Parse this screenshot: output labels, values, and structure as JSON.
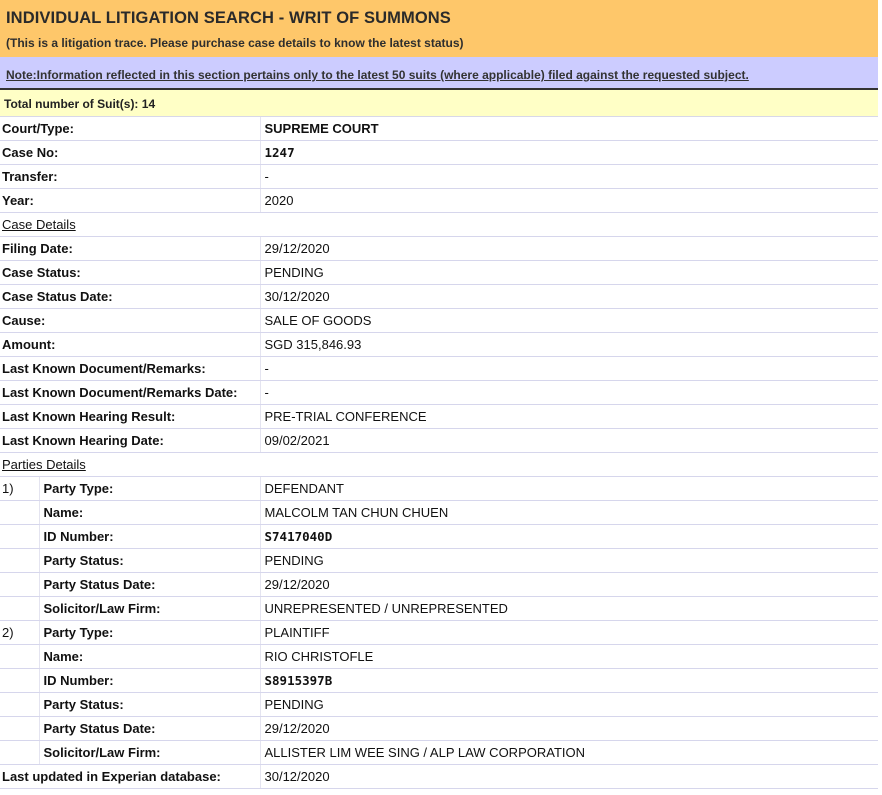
{
  "header": {
    "title": "INDIVIDUAL LITIGATION SEARCH - WRIT OF SUMMONS",
    "subtitle": "(This is a litigation trace. Please purchase case details to know the latest status)",
    "note": "Note:Information reflected in this section pertains only to the latest 50 suits (where applicable) filed against the requested subject.",
    "total": "Total number of Suit(s): 14"
  },
  "case": {
    "court_type_label": "Court/Type:",
    "court_type": "SUPREME COURT",
    "case_no_label": "Case No:",
    "case_no": "1247",
    "transfer_label": "Transfer:",
    "transfer": "-",
    "year_label": "Year:",
    "year": "2020"
  },
  "case_details": {
    "heading": "Case Details",
    "filing_date_label": "Filing Date:",
    "filing_date": "29/12/2020",
    "status_label": "Case Status:",
    "status": "PENDING",
    "status_date_label": "Case Status Date:",
    "status_date": "30/12/2020",
    "cause_label": "Cause:",
    "cause": "SALE OF GOODS",
    "amount_label": "Amount:",
    "amount": "SGD 315,846.93",
    "last_doc_label": "Last Known Document/Remarks:",
    "last_doc": "-",
    "last_doc_date_label": "Last Known Document/Remarks Date:",
    "last_doc_date": "-",
    "hearing_result_label": "Last Known Hearing Result:",
    "hearing_result": "PRE-TRIAL CONFERENCE",
    "hearing_date_label": "Last Known Hearing Date:",
    "hearing_date": "09/02/2021"
  },
  "parties": {
    "heading": "Parties Details",
    "labels": {
      "type": "Party Type:",
      "name": "Name:",
      "id": "ID Number:",
      "status": "Party Status:",
      "status_date": "Party Status Date:",
      "solicitor": "Solicitor/Law Firm:"
    },
    "items": [
      {
        "num": "1)",
        "type": "DEFENDANT",
        "name": "MALCOLM TAN CHUN CHUEN",
        "id": "S7417040D",
        "status": "PENDING",
        "status_date": "29/12/2020",
        "solicitor": "UNREPRESENTED / UNREPRESENTED"
      },
      {
        "num": "2)",
        "type": "PLAINTIFF",
        "name": "RIO CHRISTOFLE",
        "id": "S8915397B",
        "status": "PENDING",
        "status_date": "29/12/2020",
        "solicitor": "ALLISTER LIM WEE SING / ALP LAW CORPORATION"
      }
    ]
  },
  "footer": {
    "last_updated_label": "Last updated in Experian database:",
    "last_updated": "30/12/2020"
  }
}
